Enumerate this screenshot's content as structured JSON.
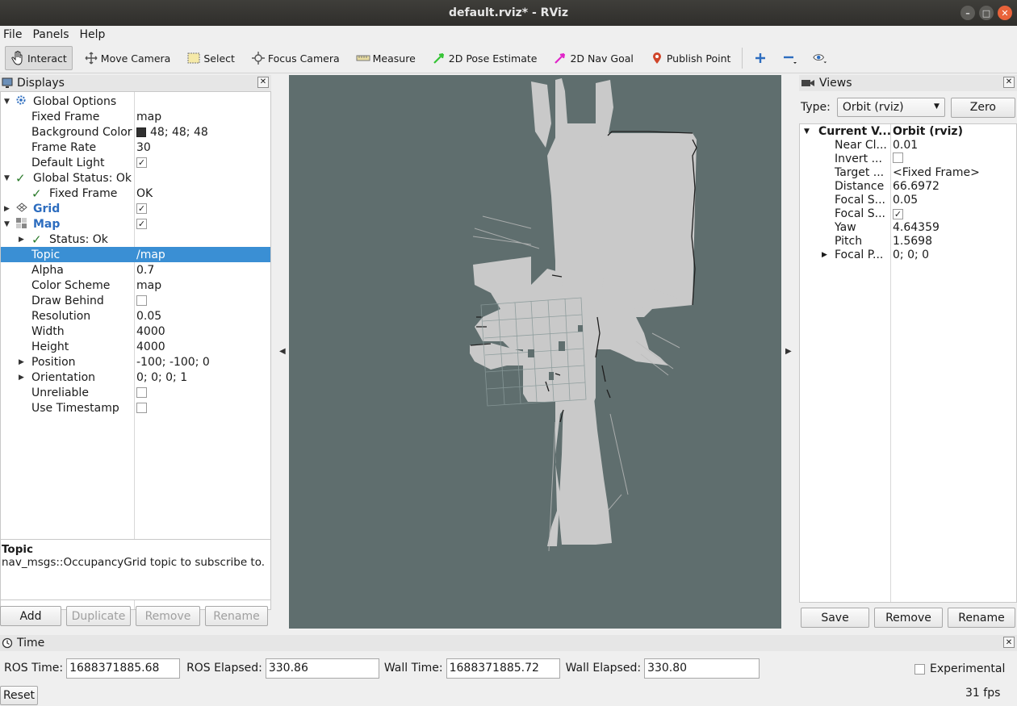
{
  "window": {
    "title": "default.rviz* - RViz"
  },
  "menu": [
    "File",
    "Panels",
    "Help"
  ],
  "toolbar": {
    "tools": [
      {
        "label": "Interact",
        "icon": "hand-icon",
        "active": true
      },
      {
        "label": "Move Camera",
        "icon": "move-camera-icon"
      },
      {
        "label": "Select",
        "icon": "select-icon"
      },
      {
        "label": "Focus Camera",
        "icon": "focus-camera-icon"
      },
      {
        "label": "Measure",
        "icon": "measure-icon"
      },
      {
        "label": "2D Pose Estimate",
        "icon": "pose-estimate-arrow-icon",
        "color": "#35c435"
      },
      {
        "label": "2D Nav Goal",
        "icon": "nav-goal-arrow-icon",
        "color": "#e024c8"
      },
      {
        "label": "Publish Point",
        "icon": "map-pin-icon",
        "color": "#d0452a"
      }
    ],
    "extra_icons": [
      "plus-icon",
      "minus-icon",
      "eye-icon"
    ]
  },
  "displays": {
    "title": "Displays",
    "rows": [
      {
        "name": "Global Options",
        "value": ""
      },
      {
        "name": "Fixed Frame",
        "value": "map"
      },
      {
        "name": "Background Color",
        "value": "48; 48; 48"
      },
      {
        "name": "Frame Rate",
        "value": "30"
      },
      {
        "name": "Default Light",
        "value": ""
      },
      {
        "name": "Global Status: Ok",
        "value": ""
      },
      {
        "name": "Fixed Frame",
        "value": "OK"
      },
      {
        "name": "Grid",
        "value": ""
      },
      {
        "name": "Map",
        "value": ""
      },
      {
        "name": "Status: Ok",
        "value": ""
      },
      {
        "name": "Topic",
        "value": "/map"
      },
      {
        "name": "Alpha",
        "value": "0.7"
      },
      {
        "name": "Color Scheme",
        "value": "map"
      },
      {
        "name": "Draw Behind",
        "value": ""
      },
      {
        "name": "Resolution",
        "value": "0.05"
      },
      {
        "name": "Width",
        "value": "4000"
      },
      {
        "name": "Height",
        "value": "4000"
      },
      {
        "name": "Position",
        "value": "-100; -100; 0"
      },
      {
        "name": "Orientation",
        "value": "0; 0; 0; 1"
      },
      {
        "name": "Unreliable",
        "value": ""
      },
      {
        "name": "Use Timestamp",
        "value": ""
      }
    ],
    "help_title": "Topic",
    "help_text": "nav_msgs::OccupancyGrid topic to subscribe to.",
    "buttons": [
      "Add",
      "Duplicate",
      "Remove",
      "Rename"
    ]
  },
  "views": {
    "title": "Views",
    "type_label": "Type:",
    "type_value": "Orbit (rviz)",
    "zero_button": "Zero",
    "header_name": "Current V...",
    "header_value": "Orbit (rviz)",
    "rows": [
      {
        "name": "Near Cl...",
        "value": "0.01"
      },
      {
        "name": "Invert ...",
        "value": ""
      },
      {
        "name": "Target ...",
        "value": "<Fixed Frame>"
      },
      {
        "name": "Distance",
        "value": "66.6972"
      },
      {
        "name": "Focal S...",
        "value": "0.05"
      },
      {
        "name": "Focal S...",
        "value": ""
      },
      {
        "name": "Yaw",
        "value": "4.64359"
      },
      {
        "name": "Pitch",
        "value": "1.5698"
      },
      {
        "name": "Focal P...",
        "value": "0; 0; 0"
      }
    ],
    "buttons": [
      "Save",
      "Remove",
      "Rename"
    ]
  },
  "time": {
    "title": "Time",
    "ros_time_label": "ROS Time:",
    "ros_time": "1688371885.68",
    "ros_elapsed_label": "ROS Elapsed:",
    "ros_elapsed": "330.86",
    "wall_time_label": "Wall Time:",
    "wall_time": "1688371885.72",
    "wall_elapsed_label": "Wall Elapsed:",
    "wall_elapsed": "330.80",
    "experimental_label": "Experimental",
    "reset_button": "Reset",
    "fps": "31 fps"
  },
  "colors": {
    "selection": "#3a8fd4",
    "viewport_bg": "#5f6e6e",
    "map_free": "#c8c8c8"
  }
}
